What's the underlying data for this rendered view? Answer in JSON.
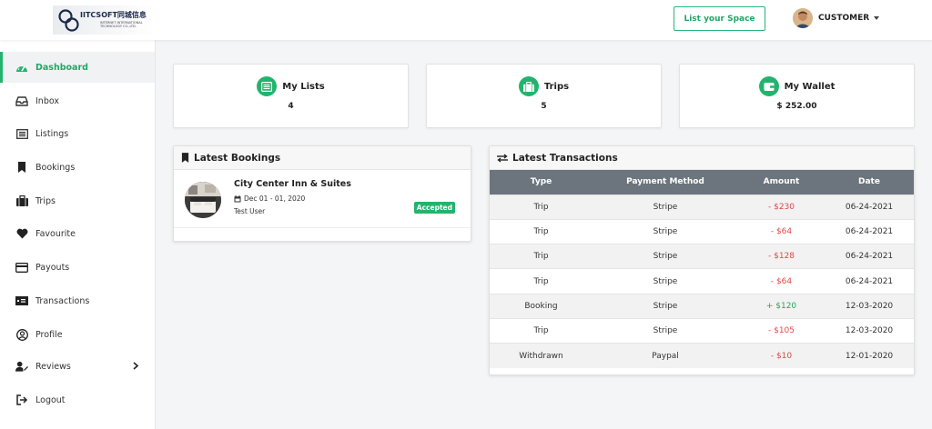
{
  "header": {
    "logo_text": "IITCSOFT同城信息",
    "logo_sub_1": "INTERNET INTERNATIONAL",
    "logo_sub_2": "TECHNOLOGY CO.,LTD.",
    "list_space_label": "List your Space",
    "user_name": "CUSTOMER"
  },
  "sidebar": {
    "items": [
      {
        "label": "Dashboard",
        "icon": "dashboard-icon"
      },
      {
        "label": "Inbox",
        "icon": "inbox-icon"
      },
      {
        "label": "Listings",
        "icon": "listings-icon"
      },
      {
        "label": "Bookings",
        "icon": "bookmark-icon"
      },
      {
        "label": "Trips",
        "icon": "suitcase-icon"
      },
      {
        "label": "Favourite",
        "icon": "heart-icon"
      },
      {
        "label": "Payouts",
        "icon": "credit-card-icon"
      },
      {
        "label": "Transactions",
        "icon": "money-icon"
      },
      {
        "label": "Profile",
        "icon": "user-circle-icon"
      },
      {
        "label": "Reviews",
        "icon": "user-edit-icon"
      },
      {
        "label": "Logout",
        "icon": "logout-icon"
      }
    ]
  },
  "stats": [
    {
      "title": "My Lists",
      "value": "4",
      "icon": "list-icon"
    },
    {
      "title": "Trips",
      "value": "5",
      "icon": "suitcase-icon"
    },
    {
      "title": "My Wallet",
      "value": "$ 252.00",
      "icon": "wallet-icon"
    }
  ],
  "bookings": {
    "title": "Latest Bookings",
    "items": [
      {
        "name": "City Center Inn & Suites",
        "date": "Dec 01 - 01, 2020",
        "user": "Test User",
        "status": "Accepted"
      }
    ]
  },
  "transactions": {
    "title": "Latest Transactions",
    "columns": [
      "Type",
      "Payment Method",
      "Amount",
      "Date"
    ],
    "rows": [
      {
        "type": "Trip",
        "method": "Stripe",
        "amount": "- $230",
        "date": "06-24-2021"
      },
      {
        "type": "Trip",
        "method": "Stripe",
        "amount": "- $64",
        "date": "06-24-2021"
      },
      {
        "type": "Trip",
        "method": "Stripe",
        "amount": "- $128",
        "date": "06-24-2021"
      },
      {
        "type": "Trip",
        "method": "Stripe",
        "amount": "- $64",
        "date": "06-24-2021"
      },
      {
        "type": "Booking",
        "method": "Stripe",
        "amount": "+ $120",
        "date": "12-03-2020"
      },
      {
        "type": "Trip",
        "method": "Stripe",
        "amount": "- $105",
        "date": "12-03-2020"
      },
      {
        "type": "Withdrawn",
        "method": "Paypal",
        "amount": "- $10",
        "date": "12-01-2020"
      }
    ]
  },
  "colors": {
    "accent": "#22b46e",
    "table_header": "#6c757d",
    "negative": "#e04848",
    "positive": "#22a85c"
  }
}
